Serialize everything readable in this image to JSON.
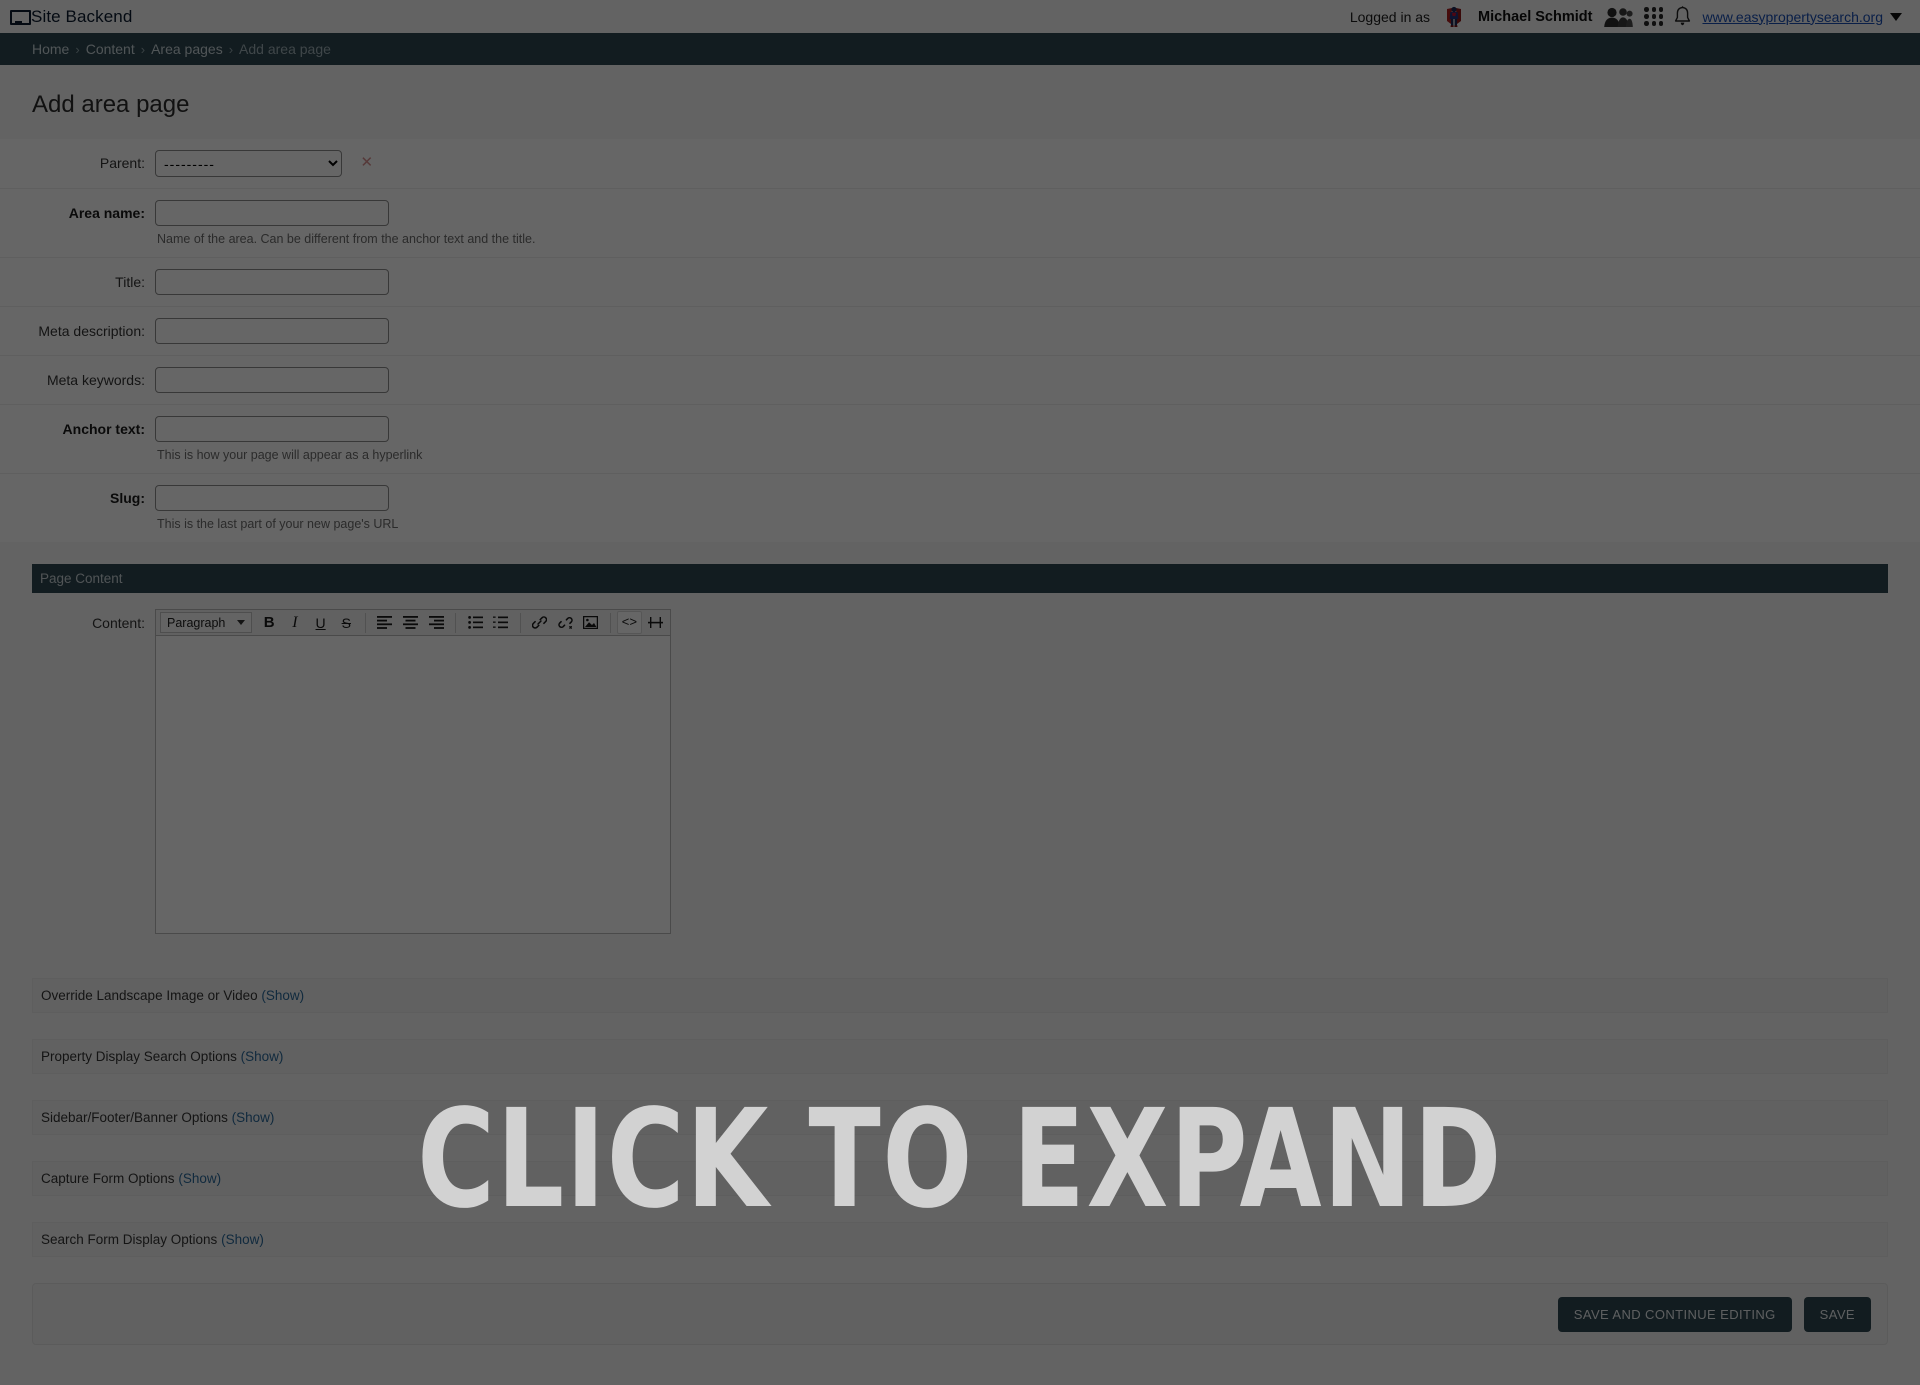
{
  "header": {
    "brand": "Site Backend",
    "brand_icon": "monitor-icon",
    "logged_in_label": "Logged in as",
    "username": "Michael Schmidt",
    "avatar_icon": "superhero-avatar-icon",
    "people_icon": "people-icon",
    "apps_icon": "apps-grid-icon",
    "notifications_icon": "bell-icon",
    "site_url": "www.easypropertysearch.org",
    "site_dropdown_icon": "chevron-down-icon"
  },
  "breadcrumb": {
    "items": [
      {
        "label": "Home",
        "current": false
      },
      {
        "label": "Content",
        "current": false
      },
      {
        "label": "Area pages",
        "current": false
      },
      {
        "label": "Add area page",
        "current": true
      }
    ],
    "separator": "›"
  },
  "page": {
    "title": "Add area page"
  },
  "form": {
    "rows": [
      {
        "label": "Parent:",
        "required": false,
        "type": "select",
        "value": "---------",
        "options": [
          "---------"
        ],
        "clear_icon": "clear-x-icon",
        "help": ""
      },
      {
        "label": "Area name:",
        "required": true,
        "type": "text",
        "value": "",
        "help": "Name of the area. Can be different from the anchor text and the title."
      },
      {
        "label": "Title:",
        "required": false,
        "type": "text",
        "value": "",
        "help": ""
      },
      {
        "label": "Meta description:",
        "required": false,
        "type": "text",
        "value": "",
        "help": ""
      },
      {
        "label": "Meta keywords:",
        "required": false,
        "type": "text",
        "value": "",
        "help": ""
      },
      {
        "label": "Anchor text:",
        "required": true,
        "type": "text",
        "value": "",
        "help": "This is how your page will appear as a hyperlink"
      },
      {
        "label": "Slug:",
        "required": true,
        "type": "text",
        "value": "",
        "help": "This is the last part of your new page's URL"
      }
    ]
  },
  "page_content": {
    "section_title": "Page Content",
    "content_label": "Content:",
    "editor": {
      "format_select": "Paragraph",
      "format_options": [
        "Paragraph"
      ],
      "value": "",
      "buttons": [
        {
          "name": "bold-icon",
          "glyph": "B",
          "style": "bold",
          "active": false
        },
        {
          "name": "italic-icon",
          "glyph": "I",
          "style": "ital",
          "active": false
        },
        {
          "name": "underline-icon",
          "glyph": "U",
          "style": "under",
          "active": false
        },
        {
          "name": "strikethrough-icon",
          "glyph": "S",
          "style": "strike",
          "active": false
        },
        {
          "name": "divider",
          "glyph": "",
          "style": "divider",
          "active": false
        },
        {
          "name": "align-left-icon",
          "glyph": "",
          "style": "svg-align-left",
          "active": false
        },
        {
          "name": "align-center-icon",
          "glyph": "",
          "style": "svg-align-center",
          "active": false
        },
        {
          "name": "align-right-icon",
          "glyph": "",
          "style": "svg-align-right",
          "active": false
        },
        {
          "name": "divider",
          "glyph": "",
          "style": "divider",
          "active": false
        },
        {
          "name": "bullet-list-icon",
          "glyph": "",
          "style": "svg-ul",
          "active": false
        },
        {
          "name": "numbered-list-icon",
          "glyph": "",
          "style": "svg-ol",
          "active": false
        },
        {
          "name": "divider",
          "glyph": "",
          "style": "divider",
          "active": false
        },
        {
          "name": "link-icon",
          "glyph": "",
          "style": "svg-link",
          "active": false
        },
        {
          "name": "unlink-icon",
          "glyph": "",
          "style": "svg-unlink",
          "active": false
        },
        {
          "name": "image-icon",
          "glyph": "",
          "style": "svg-image",
          "active": false
        },
        {
          "name": "divider",
          "glyph": "",
          "style": "divider",
          "active": false
        },
        {
          "name": "source-code-icon",
          "glyph": "<>",
          "style": "code",
          "active": true
        },
        {
          "name": "horizontal-rule-icon",
          "glyph": "",
          "style": "svg-hr",
          "active": false
        }
      ]
    }
  },
  "option_sections": [
    {
      "title": "Override Landscape Image or Video",
      "toggle": "(Show)",
      "name": "override-landscape-image-or-video"
    },
    {
      "title": "Property Display Search Options",
      "toggle": "(Show)",
      "name": "property-display-search-options"
    },
    {
      "title": "Sidebar/Footer/Banner Options",
      "toggle": "(Show)",
      "name": "sidebar-footer-banner-options"
    },
    {
      "title": "Capture Form Options",
      "toggle": "(Show)",
      "name": "capture-form-options"
    },
    {
      "title": "Search Form Display Options",
      "toggle": "(Show)",
      "name": "search-form-display-options"
    }
  ],
  "actions": {
    "save_and_continue": "SAVE AND CONTINUE EDITING",
    "save": "SAVE"
  },
  "overlay": {
    "text": "CLICK TO EXPAND"
  },
  "colors": {
    "brand_dark": "#2f4750",
    "link_blue": "#2b6a9b",
    "site_link_blue": "#1a4fb4",
    "clear_x_red": "#d88f8f",
    "overlay_text": "#d2d2d2",
    "page_bg": "#f8f8f8"
  }
}
